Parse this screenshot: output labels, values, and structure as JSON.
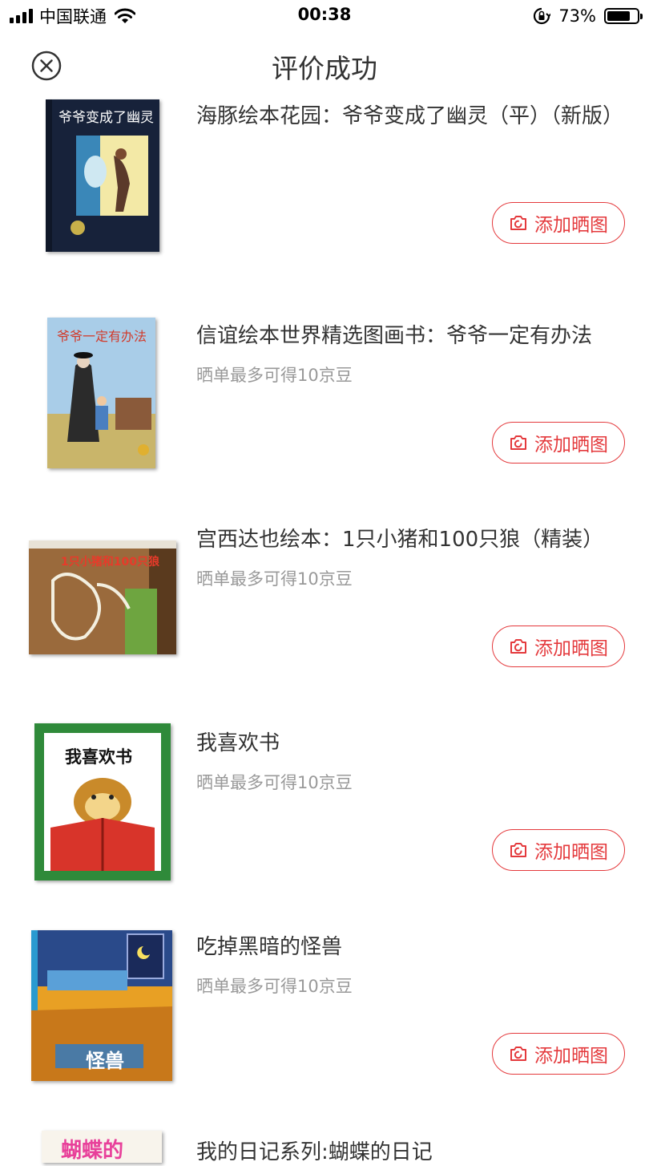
{
  "status_bar": {
    "carrier": "中国联通",
    "time": "00:38",
    "battery_percent": "73%",
    "battery_level": 0.73
  },
  "header": {
    "title": "评价成功"
  },
  "items": [
    {
      "title": "海豚绘本花园：爷爷变成了幽灵（平）（新版）",
      "reward": "",
      "button": "添加晒图",
      "cover_text": "爷爷变成了幽灵"
    },
    {
      "title": "信谊绘本世界精选图画书：爷爷一定有办法",
      "reward": "晒单最多可得10京豆",
      "button": "添加晒图",
      "cover_text": "爷爷一定有办法"
    },
    {
      "title": "宫西达也绘本：1只小猪和100只狼（精装）",
      "reward": "晒单最多可得10京豆",
      "button": "添加晒图",
      "cover_text": "1只小猪和100只狼"
    },
    {
      "title": "我喜欢书",
      "reward": "晒单最多可得10京豆",
      "button": "添加晒图",
      "cover_text": "我喜欢书"
    },
    {
      "title": "吃掉黑暗的怪兽",
      "reward": "晒单最多可得10京豆",
      "button": "添加晒图",
      "cover_text": "怪兽"
    },
    {
      "title": "我的日记系列:蝴蝶的日记",
      "reward": "",
      "button": "",
      "cover_text": "蝴蝶的"
    }
  ],
  "colors": {
    "accent": "#e4393c",
    "text": "#333333",
    "subtext": "#999999"
  }
}
